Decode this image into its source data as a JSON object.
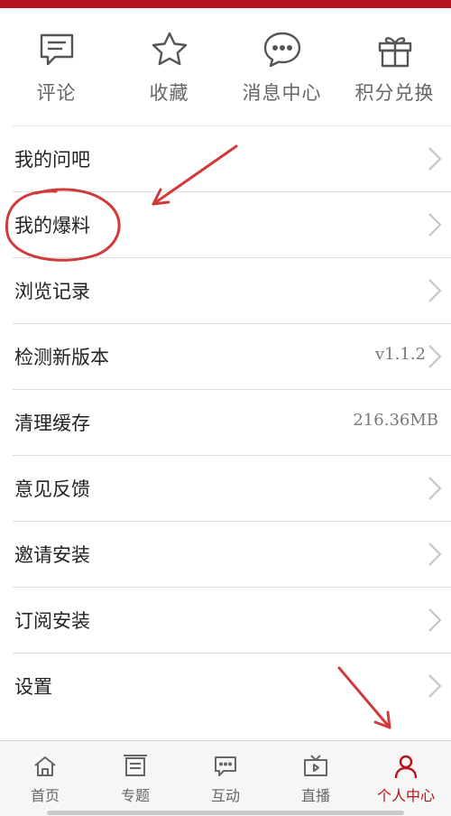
{
  "colors": {
    "accent": "#b5121b",
    "annotation": "#d13a3a"
  },
  "quick_actions": [
    {
      "label": "评论",
      "icon": "comment-icon"
    },
    {
      "label": "收藏",
      "icon": "star-icon"
    },
    {
      "label": "消息中心",
      "icon": "message-icon"
    },
    {
      "label": "积分兑换",
      "icon": "gift-icon"
    }
  ],
  "menu": [
    {
      "label": "我的问吧",
      "value": ""
    },
    {
      "label": "我的爆料",
      "value": ""
    },
    {
      "label": "浏览记录",
      "value": ""
    },
    {
      "label": "检测新版本",
      "value": "v1.1.2"
    },
    {
      "label": "清理缓存",
      "value": "216.36MB"
    },
    {
      "label": "意见反馈",
      "value": ""
    },
    {
      "label": "邀请安装",
      "value": ""
    },
    {
      "label": "订阅安装",
      "value": ""
    },
    {
      "label": "设置",
      "value": ""
    }
  ],
  "tabs": [
    {
      "label": "首页",
      "icon": "home-icon",
      "active": false
    },
    {
      "label": "专题",
      "icon": "topic-icon",
      "active": false
    },
    {
      "label": "互动",
      "icon": "interact-icon",
      "active": false
    },
    {
      "label": "直播",
      "icon": "tv-icon",
      "active": false
    },
    {
      "label": "个人中心",
      "icon": "person-icon",
      "active": true
    }
  ]
}
